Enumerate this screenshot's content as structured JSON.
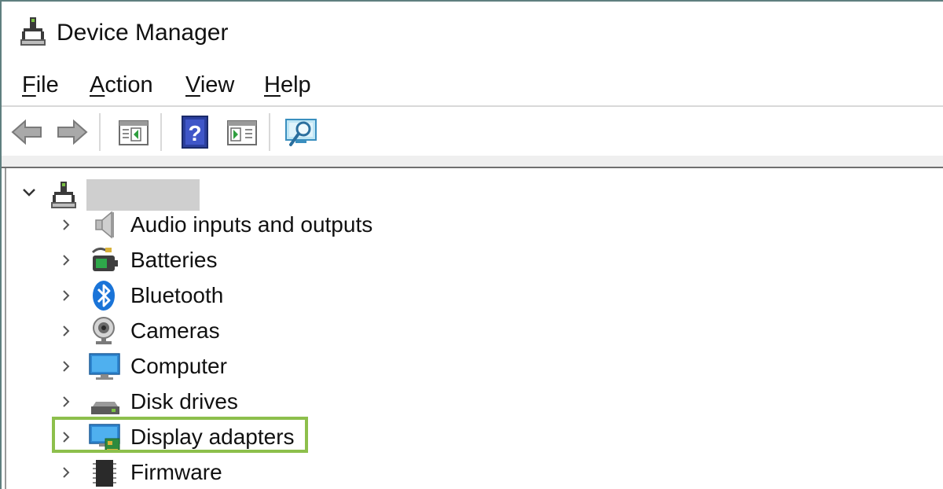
{
  "window": {
    "title": "Device Manager"
  },
  "menubar": {
    "items": [
      {
        "label_mnemonic": "F",
        "label_rest": "ile"
      },
      {
        "label_mnemonic": "A",
        "label_rest": "ction"
      },
      {
        "label_mnemonic": "V",
        "label_rest": "iew"
      },
      {
        "label_mnemonic": "H",
        "label_rest": "elp"
      }
    ]
  },
  "toolbar": {
    "buttons": [
      {
        "icon": "back-arrow-icon"
      },
      {
        "icon": "forward-arrow-icon"
      },
      {
        "icon": "show-hide-console-tree-icon"
      },
      {
        "icon": "help-icon"
      },
      {
        "icon": "show-hide-action-pane-icon"
      },
      {
        "icon": "scan-for-hardware-changes-icon"
      }
    ]
  },
  "tree": {
    "root": {
      "icon": "computer-root-icon",
      "name": ""
    },
    "categories": [
      {
        "label": "Audio inputs and outputs",
        "icon": "speaker-icon"
      },
      {
        "label": "Batteries",
        "icon": "battery-icon"
      },
      {
        "label": "Bluetooth",
        "icon": "bluetooth-icon"
      },
      {
        "label": "Cameras",
        "icon": "webcam-icon"
      },
      {
        "label": "Computer",
        "icon": "monitor-icon"
      },
      {
        "label": "Disk drives",
        "icon": "disk-drive-icon"
      },
      {
        "label": "Display adapters",
        "icon": "display-adapter-icon"
      },
      {
        "label": "Firmware",
        "icon": "chip-icon"
      }
    ],
    "highlighted": "Display adapters",
    "highlight_color": "#8dbf4c"
  }
}
